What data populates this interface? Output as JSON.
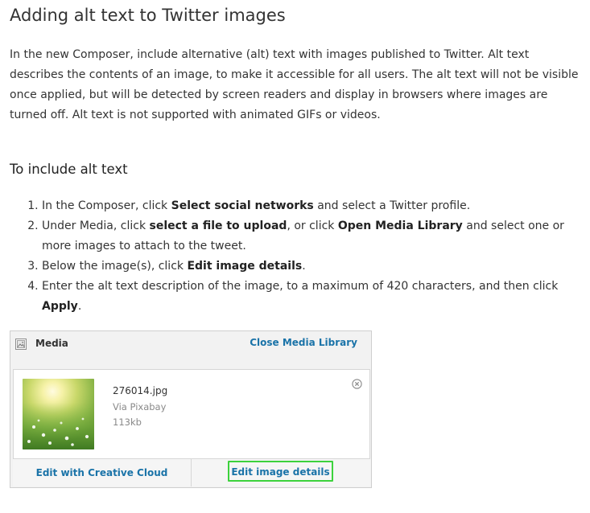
{
  "article": {
    "title": "Adding alt text to Twitter images",
    "intro": "In the new Composer, include alternative (alt) text with images published to Twitter. Alt text describes the contents of an image, to make it accessible for all users. The alt text will not be visible once applied, but will be detected by screen readers and display in browsers where images are turned off. Alt text is not supported with animated GIFs or videos.",
    "section_heading": "To include alt text",
    "steps": [
      {
        "t1": "In the Composer, click ",
        "b1": "Select social networks",
        "t2": " and select a Twitter profile."
      },
      {
        "t1": "Under Media, click ",
        "b1": "select a file to upload",
        "t2": ", or click ",
        "b2": "Open Media Library",
        "t3": " and select one or more images to attach to the tweet."
      },
      {
        "t1": "Below the image(s), click ",
        "b1": "Edit image details",
        "t2": "."
      },
      {
        "t1": "Enter the alt text description of the image, to a maximum of 420 characters, and then click ",
        "b1": "Apply",
        "t2": "."
      }
    ]
  },
  "media_panel": {
    "label": "Media",
    "icon": "image-icon",
    "close_label": "Close Media Library",
    "file": {
      "name": "276014.jpg",
      "source": "Via Pixabay",
      "size": "113kb",
      "remove_icon": "close-circle-icon"
    },
    "actions": {
      "edit_creative_cloud": "Edit with Creative Cloud",
      "edit_image_details": "Edit image details"
    },
    "colors": {
      "link": "#1a73a8",
      "highlight": "#3cd23c"
    }
  }
}
